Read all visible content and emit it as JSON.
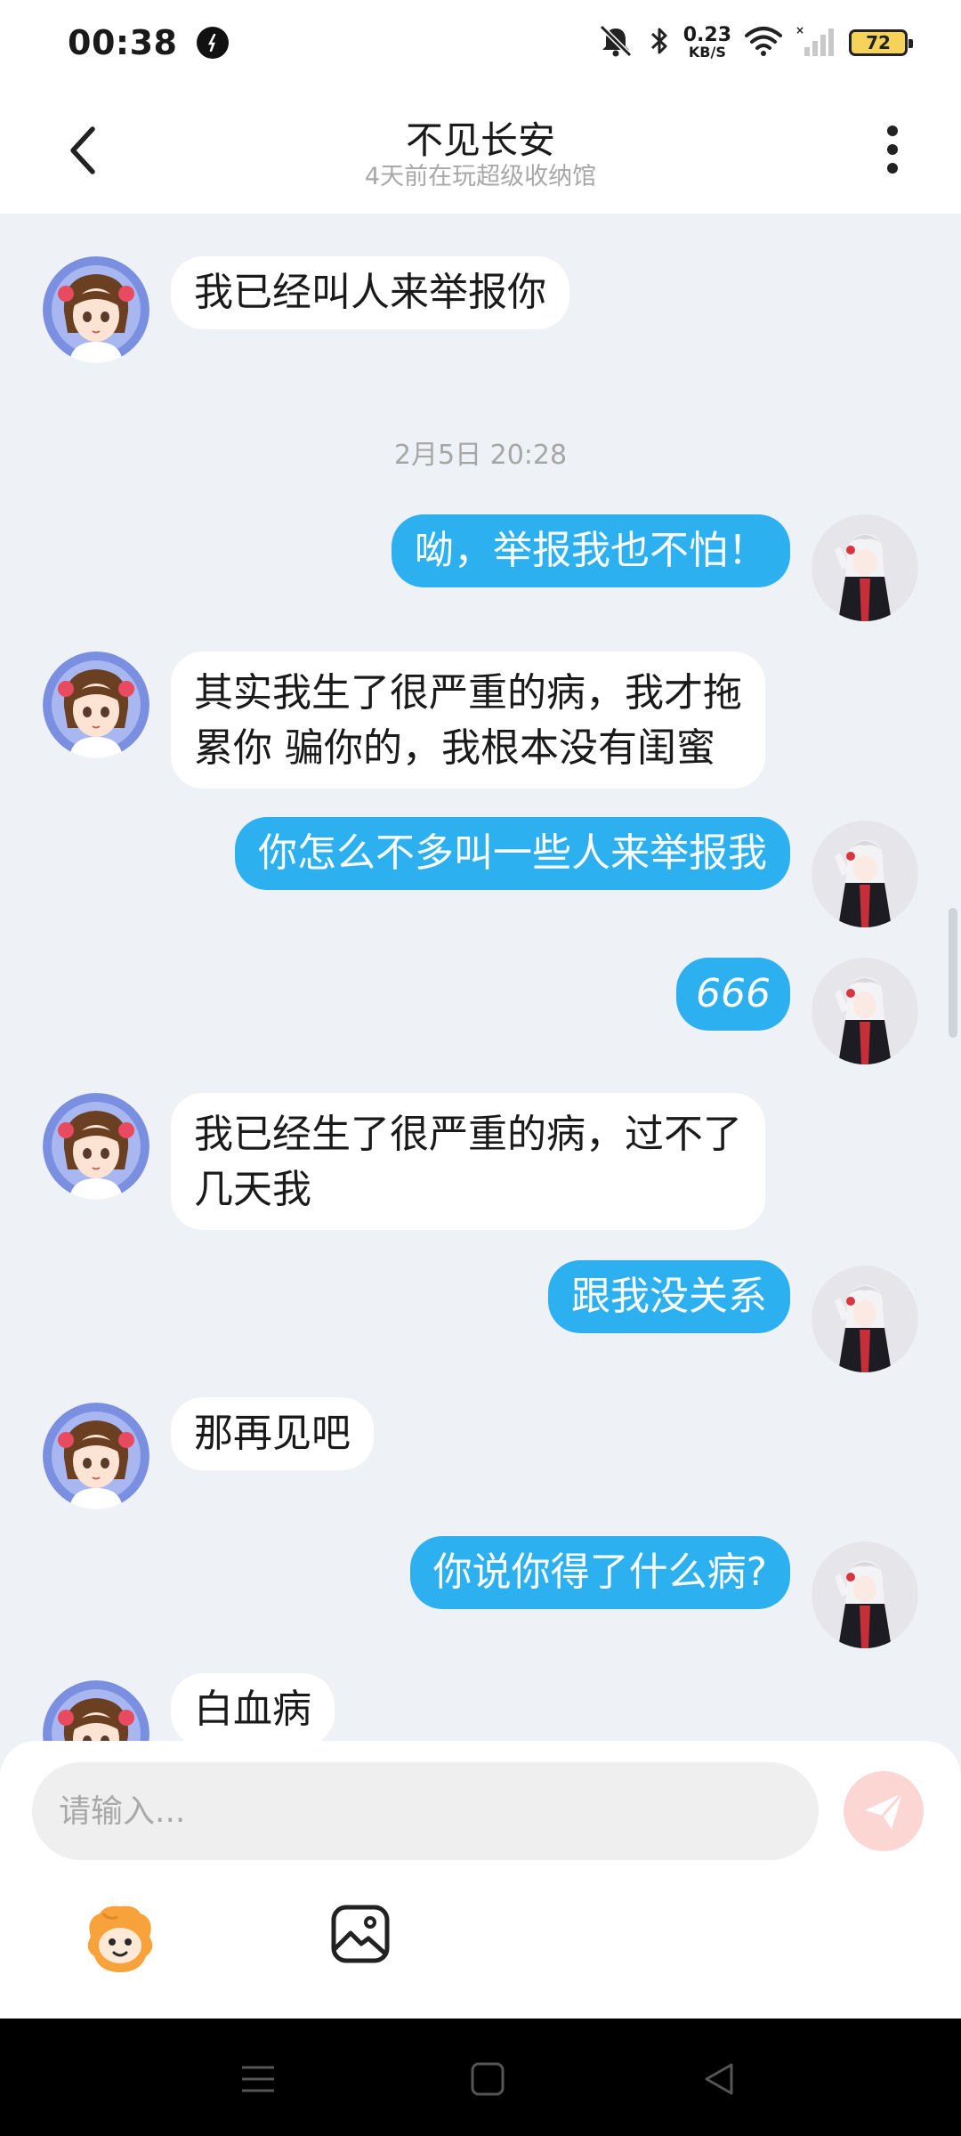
{
  "status_bar": {
    "time": "00:38",
    "net_speed_value": "0.23",
    "net_speed_unit": "KB/S",
    "battery": "72"
  },
  "header": {
    "title": "不见长安",
    "subtitle": "4天前在玩超级收纳馆"
  },
  "messages": [
    {
      "side": "in",
      "text": "我已经叫人来举报你"
    },
    {
      "type": "timestamp",
      "text": "2月5日 20:28"
    },
    {
      "side": "out",
      "text": "呦，举报我也不怕！"
    },
    {
      "side": "in",
      "text": "其实我生了很严重的病，我才拖\n累你 骗你的，我根本没有闺蜜"
    },
    {
      "side": "out",
      "text": "你怎么不多叫一些人来举报我"
    },
    {
      "side": "out",
      "text": "666"
    },
    {
      "side": "in",
      "text": "我已经生了很严重的病，过不了\n几天我"
    },
    {
      "side": "out",
      "text": "跟我没关系"
    },
    {
      "side": "in",
      "text": "那再见吧"
    },
    {
      "side": "out",
      "text": "你说你得了什么病?"
    },
    {
      "side": "in",
      "text": "白血病"
    }
  ],
  "input": {
    "placeholder": "请输入..."
  },
  "toolbar": {
    "emoji_icon": "emoji-mascot-icon",
    "image_icon": "image-icon",
    "send_icon": "send-icon"
  },
  "colors": {
    "outgoing_bubble": "#2db0f0",
    "incoming_bubble": "#ffffff",
    "chat_background": "#eef1f6",
    "send_button": "#fbd6d3"
  }
}
